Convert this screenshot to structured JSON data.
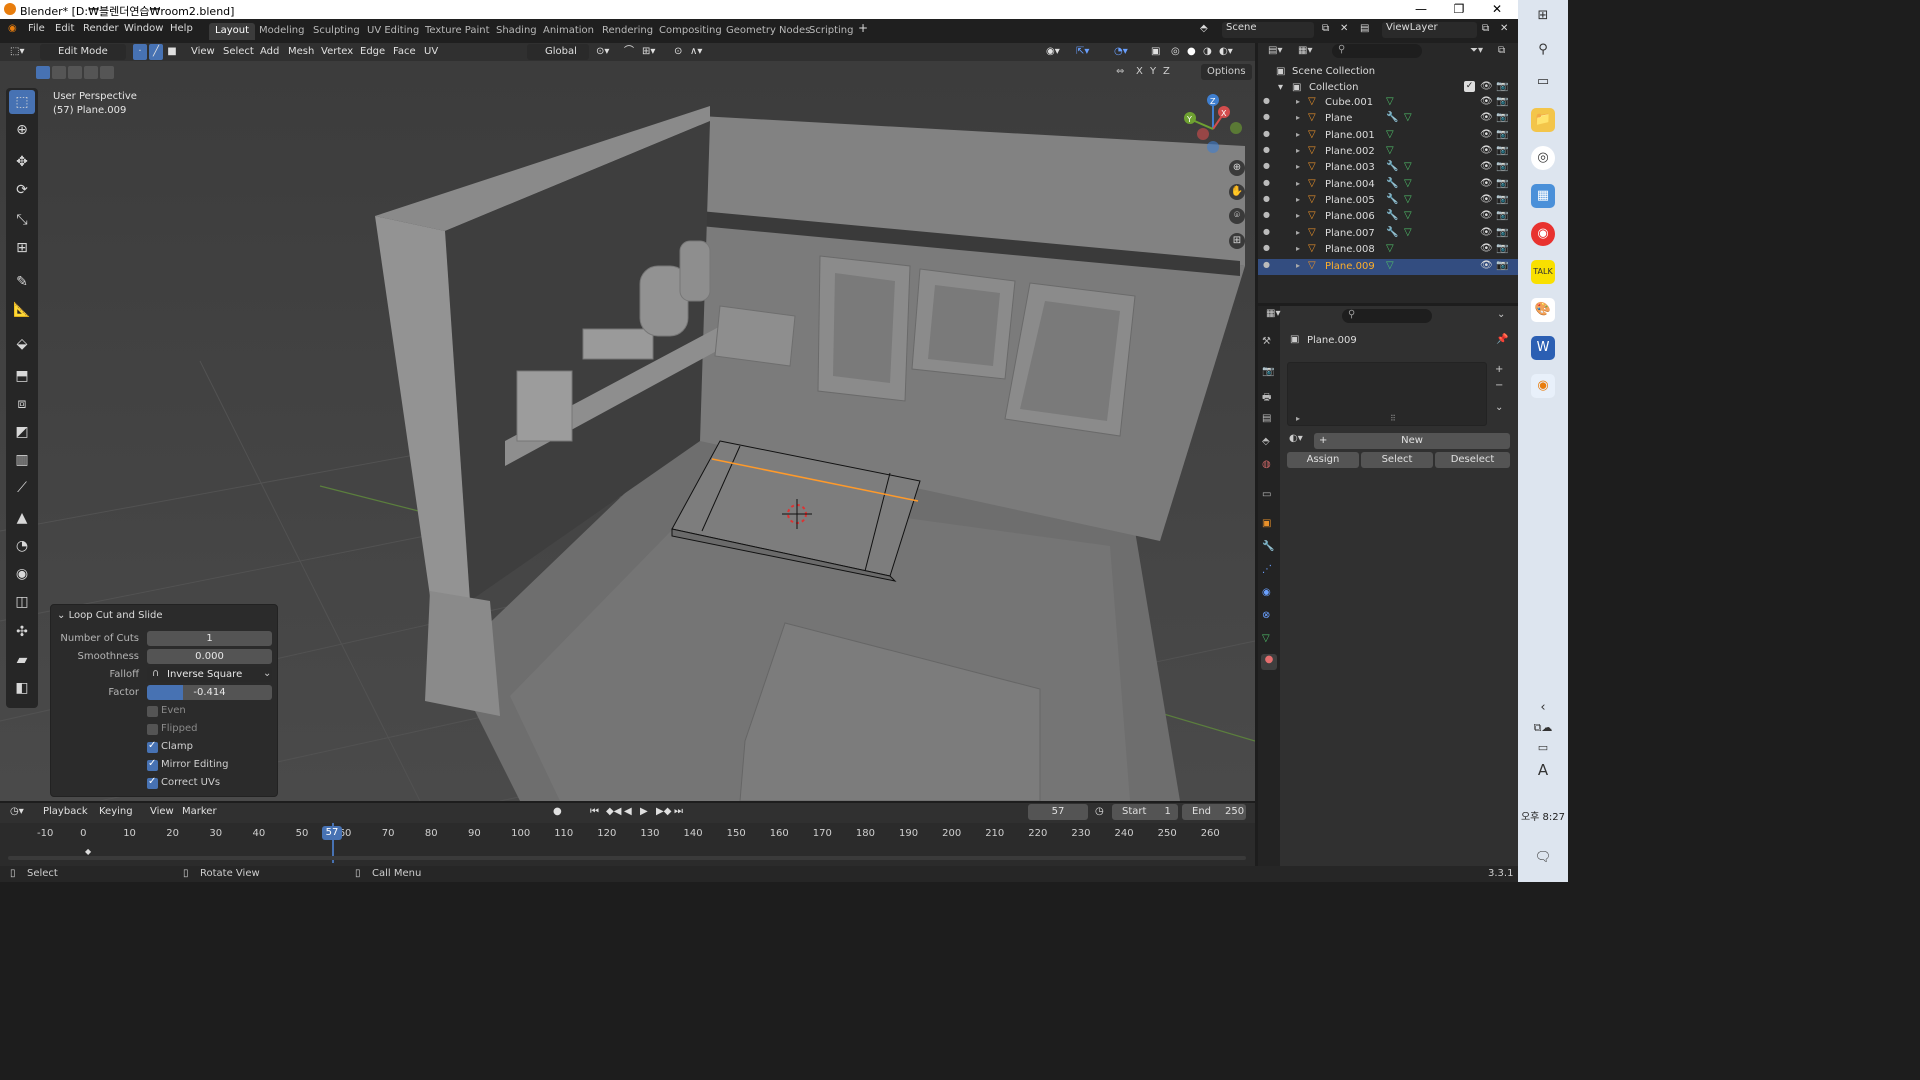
{
  "window": {
    "title": "Blender* [D:₩블렌더연습₩room2.blend]",
    "controls": [
      "—",
      "❐",
      "✕"
    ]
  },
  "menu": {
    "items": [
      "File",
      "Edit",
      "Render",
      "Window",
      "Help"
    ]
  },
  "workspaces": [
    "Layout",
    "Modeling",
    "Sculpting",
    "UV Editing",
    "Texture Paint",
    "Shading",
    "Animation",
    "Rendering",
    "Compositing",
    "Geometry Nodes",
    "Scripting"
  ],
  "active_workspace": "Layout",
  "scene": {
    "label": "Scene",
    "viewlayer": "ViewLayer"
  },
  "header": {
    "mode": "Edit Mode",
    "menus": [
      "View",
      "Select",
      "Add",
      "Mesh",
      "Vertex",
      "Edge",
      "Face",
      "UV"
    ],
    "orientation": "Global",
    "options": "Options",
    "axes": [
      "X",
      "Y",
      "Z"
    ]
  },
  "viewport": {
    "perspective": "User Perspective",
    "object": "(57) Plane.009"
  },
  "operator": {
    "title": "Loop Cut and Slide",
    "fields": [
      {
        "label": "Number of Cuts",
        "value": "1"
      },
      {
        "label": "Smoothness",
        "value": "0.000"
      },
      {
        "label": "Falloff",
        "value": "Inverse Square"
      },
      {
        "label": "Factor",
        "value": "-0.414",
        "fraction": 0.29
      }
    ],
    "checks": [
      {
        "label": "Even",
        "checked": false
      },
      {
        "label": "Flipped",
        "checked": false
      },
      {
        "label": "Clamp",
        "checked": true
      },
      {
        "label": "Mirror Editing",
        "checked": true
      },
      {
        "label": "Correct UVs",
        "checked": true
      }
    ]
  },
  "timeline": {
    "menus": [
      "Playback",
      "Keying",
      "View",
      "Marker"
    ],
    "current_frame": "57",
    "start_label": "Start",
    "start": "1",
    "end_label": "End",
    "end": "250",
    "ticks": [
      "-10",
      "0",
      "10",
      "20",
      "30",
      "40",
      "50",
      "60",
      "70",
      "80",
      "90",
      "100",
      "110",
      "120",
      "130",
      "140",
      "150",
      "160",
      "170",
      "180",
      "190",
      "200",
      "210",
      "220",
      "230",
      "240",
      "250",
      "260"
    ]
  },
  "status": {
    "select": "Select",
    "rotate": "Rotate View",
    "call": "Call Menu",
    "version": "3.3.1"
  },
  "outliner": {
    "root": "Scene Collection",
    "collection": "Collection",
    "objects": [
      "Cube.001",
      "Plane",
      "Plane.001",
      "Plane.002",
      "Plane.003",
      "Plane.004",
      "Plane.005",
      "Plane.006",
      "Plane.007",
      "Plane.008",
      "Plane.009"
    ],
    "selected": "Plane.009"
  },
  "properties": {
    "object": "Plane.009",
    "new_label": "New",
    "assign": "Assign",
    "select": "Select",
    "deselect": "Deselect"
  },
  "taskbar": {
    "time": "오후 8:27",
    "ime": "A"
  },
  "colors": {
    "accent": "#4772b3",
    "selected_text": "#ffaf29",
    "edge_highlight": "#ff9a2a"
  }
}
